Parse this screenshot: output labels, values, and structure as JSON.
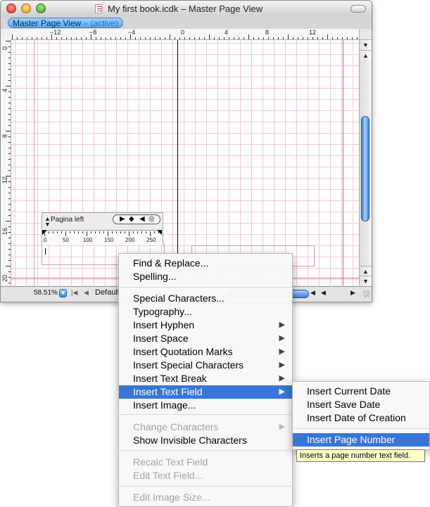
{
  "window": {
    "title": "My first book.icdk – Master Page View",
    "tab_label": "Master Page View",
    "tab_state": " – (active)"
  },
  "ruler": {
    "h_labels": [
      "−12",
      "−8",
      "−4",
      "0",
      "4",
      "8",
      "12"
    ],
    "v_labels": [
      "0",
      "4",
      "8",
      "12",
      "16",
      "20"
    ]
  },
  "paragraph_palette": {
    "style_name": "Pagina left",
    "ruler_labels": [
      "0",
      "50",
      "100",
      "150",
      "200",
      "250"
    ],
    "align_icons": [
      "align-right-triangle-icon",
      "align-center-diamond-icon",
      "align-left-triangle-icon",
      "align-decimal-icon"
    ]
  },
  "bottom_bar": {
    "zoom": "58.51%",
    "master_page": "Default"
  },
  "context_menu": {
    "items": [
      {
        "label": "Find & Replace...",
        "enabled": true,
        "submenu": false
      },
      {
        "label": "Spelling...",
        "enabled": true,
        "submenu": false
      },
      {
        "label": "Special Characters...",
        "enabled": true,
        "submenu": false
      },
      {
        "label": "Typography...",
        "enabled": true,
        "submenu": false
      },
      {
        "label": "Insert Hyphen",
        "enabled": true,
        "submenu": true
      },
      {
        "label": "Insert Space",
        "enabled": true,
        "submenu": true
      },
      {
        "label": "Insert Quotation Marks",
        "enabled": true,
        "submenu": true
      },
      {
        "label": "Insert Special Characters",
        "enabled": true,
        "submenu": true
      },
      {
        "label": "Insert Text Break",
        "enabled": true,
        "submenu": true
      },
      {
        "label": "Insert Text Field",
        "enabled": true,
        "submenu": true,
        "selected": true
      },
      {
        "label": "Insert Image...",
        "enabled": true,
        "submenu": false
      },
      {
        "label": "Change Characters",
        "enabled": false,
        "submenu": true
      },
      {
        "label": "Show Invisible Characters",
        "enabled": true,
        "submenu": false
      },
      {
        "label": "Recalc Text Field",
        "enabled": false,
        "submenu": false
      },
      {
        "label": "Edit Text Field...",
        "enabled": false,
        "submenu": false
      },
      {
        "label": "Edit Image Size...",
        "enabled": false,
        "submenu": false
      }
    ]
  },
  "submenu": {
    "items": [
      {
        "label": "Insert Current Date",
        "selected": false
      },
      {
        "label": "Insert Save Date",
        "selected": false
      },
      {
        "label": "Insert Date of Creation",
        "selected": false
      },
      {
        "label": "Insert Page Number",
        "selected": true
      }
    ]
  },
  "tooltip": "Inserts a page number text field."
}
